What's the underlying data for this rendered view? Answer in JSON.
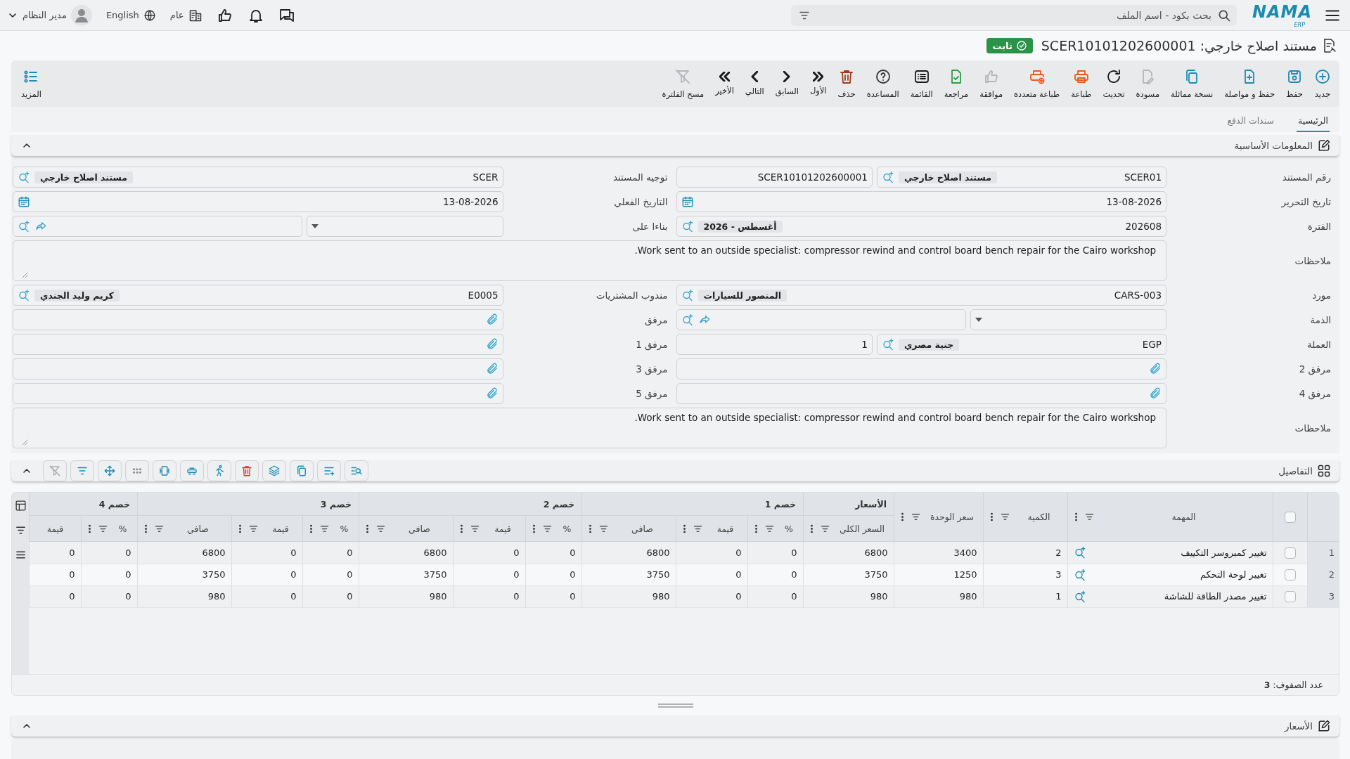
{
  "topbar": {
    "logo": "NAMA",
    "logo_sub": "ERP",
    "search": {
      "placeholder": "بحث بكود - اسم الملف"
    },
    "branch": "عام",
    "language": "English",
    "user": "مدير النظام"
  },
  "document": {
    "title": "مستند اصلاح خارجي: SCER10101202600001",
    "status": "ثابت"
  },
  "toolbar": [
    {
      "label": "جديد",
      "color": "#1e8bb5",
      "disabled": false
    },
    {
      "label": "حفظ",
      "color": "#1e8bb5",
      "disabled": false
    },
    {
      "label": "حفظ و مواصلة",
      "color": "#1e8bb5",
      "disabled": false
    },
    {
      "label": "نسخة مماثلة",
      "color": "#1e8bb5",
      "disabled": false
    },
    {
      "label": "مسودة",
      "disabled": true
    },
    {
      "label": "تحديث",
      "color": "#1a1a1a",
      "disabled": false
    },
    {
      "label": "طباعة",
      "color": "#ea5a1c",
      "disabled": false
    },
    {
      "label": "طباعة متعددة",
      "color": "#ea5a1c",
      "disabled": false
    },
    {
      "label": "موافقة",
      "disabled": true
    },
    {
      "label": "مراجعة",
      "color": "#2f9e44",
      "disabled": false
    },
    {
      "label": "القائمة",
      "color": "#1a1a1a",
      "disabled": false
    },
    {
      "label": "المساعدة",
      "color": "#333333",
      "disabled": false
    },
    {
      "label": "حذف",
      "color": "#a33b20",
      "disabled": false
    },
    {
      "label": "الأول",
      "color": "#1a1a1a",
      "disabled": false
    },
    {
      "label": "السابق",
      "color": "#1a1a1a",
      "disabled": false
    },
    {
      "label": "التالي",
      "color": "#1a1a1a",
      "disabled": false
    },
    {
      "label": "الأخير",
      "color": "#1a1a1a",
      "disabled": false
    },
    {
      "label": "مسح الفلترة",
      "disabled": true
    }
  ],
  "more": "المزيد",
  "tabs": [
    {
      "label": "الرئيسية",
      "selected": true
    },
    {
      "label": "سندات الدفع",
      "selected": false
    }
  ],
  "basic_info": {
    "title": "المعلومات الأساسية",
    "rows": [
      {
        "kind": "pair",
        "fields": [
          {
            "label": "رقم المستند",
            "parts": [
              {
                "kind": "lookup",
                "code": "SCER01",
                "name": "مستند اصلاح خارجي"
              },
              {
                "kind": "text",
                "value": "SCER10101202600001"
              }
            ]
          },
          {
            "label": "توجيه المستند",
            "parts": [
              {
                "kind": "lookup",
                "code": "SCER",
                "name": "مستند اصلاح خارجي"
              }
            ]
          }
        ]
      },
      {
        "kind": "pair",
        "fields": [
          {
            "label": "تاريخ التحرير",
            "parts": [
              {
                "kind": "date",
                "value": "13-08-2026"
              }
            ]
          },
          {
            "label": "التاريخ الفعلي",
            "parts": [
              {
                "kind": "date",
                "value": "13-08-2026"
              }
            ]
          }
        ]
      },
      {
        "kind": "pair",
        "fields": [
          {
            "label": "الفترة",
            "parts": [
              {
                "kind": "lookup",
                "code": "202608",
                "name": "أغسطس - 2026"
              }
            ]
          },
          {
            "label": "بناءا على",
            "parts": [
              {
                "kind": "select"
              },
              {
                "kind": "reference"
              }
            ]
          }
        ]
      },
      {
        "kind": "notes",
        "label": "ملاحظات",
        "value": "Work sent to an outside specialist: compressor rewind and control board bench repair for the Cairo workshop."
      },
      {
        "kind": "pair",
        "fields": [
          {
            "label": "مورد",
            "parts": [
              {
                "kind": "lookup",
                "code": "CARS-003",
                "name": "المنصور للسيارات"
              }
            ]
          },
          {
            "label": "مندوب المشتريات",
            "parts": [
              {
                "kind": "lookup",
                "code": "E0005",
                "name": "كريم وليد الجندي"
              }
            ]
          }
        ]
      },
      {
        "kind": "pair",
        "fields": [
          {
            "label": "الذمة",
            "parts": [
              {
                "kind": "select"
              },
              {
                "kind": "reference"
              }
            ]
          },
          {
            "label": "مرفق",
            "parts": [
              {
                "kind": "attachment"
              }
            ]
          }
        ]
      },
      {
        "kind": "pair",
        "fields": [
          {
            "label": "العملة",
            "parts": [
              {
                "kind": "lookup",
                "code": "EGP",
                "name": "جنية مصري"
              },
              {
                "kind": "text",
                "value": "1"
              }
            ]
          },
          {
            "label": "مرفق 1",
            "parts": [
              {
                "kind": "attachment"
              }
            ]
          }
        ]
      },
      {
        "kind": "pair",
        "fields": [
          {
            "label": "مرفق 2",
            "parts": [
              {
                "kind": "attachment"
              }
            ]
          },
          {
            "label": "مرفق 3",
            "parts": [
              {
                "kind": "attachment"
              }
            ]
          }
        ]
      },
      {
        "kind": "pair",
        "fields": [
          {
            "label": "مرفق 4",
            "parts": [
              {
                "kind": "attachment"
              }
            ]
          },
          {
            "label": "مرفق 5",
            "parts": [
              {
                "kind": "attachment"
              }
            ]
          }
        ]
      },
      {
        "kind": "notes",
        "label": "ملاحظات",
        "value": "Work sent to an outside specialist: compressor rewind and control board bench repair for the Cairo workshop."
      }
    ]
  },
  "details": {
    "title": "التفاصيل",
    "table": {
      "all_selected": false,
      "columns": [
        {
          "label": "المهمة",
          "filter": true
        },
        {
          "label": "الكمية",
          "filter": true
        },
        {
          "label": "سعر الوحدة",
          "filter": true
        },
        {
          "group": "الأسعار",
          "label": "السعر الكلي",
          "filter": true
        },
        {
          "group": "خصم 1",
          "label": "%",
          "filter": true
        },
        {
          "grouped": true,
          "label": "قيمة",
          "filter": true
        },
        {
          "grouped": true,
          "label": "صافي",
          "filter": true
        },
        {
          "group": "خصم 2",
          "label": "%",
          "filter": true
        },
        {
          "grouped": true,
          "label": "قيمة",
          "filter": true
        },
        {
          "grouped": true,
          "label": "صافي",
          "filter": true
        },
        {
          "group": "خصم 3",
          "label": "%",
          "filter": true
        },
        {
          "grouped": true,
          "label": "قيمة",
          "filter": true
        },
        {
          "grouped": true,
          "label": "صافي",
          "filter": true
        },
        {
          "group": "خصم 4",
          "label": "%",
          "filter": true
        },
        {
          "grouped": true,
          "label": "قيمة",
          "filter": false
        }
      ],
      "rows": [
        {
          "number": "1",
          "selected": false,
          "cells": [
            "تغيير كمبروسر التكييف",
            "2",
            "3400",
            "6800",
            "0",
            "0",
            "6800",
            "0",
            "0",
            "6800",
            "0",
            "0",
            "6800",
            "0",
            "0"
          ]
        },
        {
          "number": "2",
          "selected": false,
          "cells": [
            "تغيير لوحة التحكم",
            "3",
            "1250",
            "3750",
            "0",
            "0",
            "3750",
            "0",
            "0",
            "3750",
            "0",
            "0",
            "3750",
            "0",
            "0"
          ]
        },
        {
          "number": "3",
          "selected": false,
          "cells": [
            "تغيير مصدر الطاقة للشاشة",
            "1",
            "980",
            "980",
            "0",
            "0",
            "980",
            "0",
            "0",
            "980",
            "0",
            "0",
            "980",
            "0",
            "0"
          ]
        }
      ]
    },
    "row_count": "عدد الصفوف: **3**"
  },
  "prices": {
    "title": "الأسعار"
  }
}
